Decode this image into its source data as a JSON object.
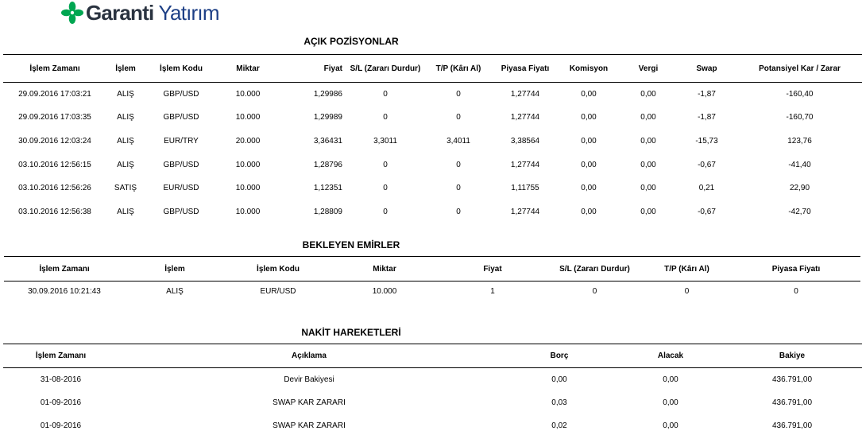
{
  "brand": {
    "name_part1": "Garanti",
    "name_part2": "Yatırım",
    "color_primary": "#2a3340",
    "color_secondary": "#1d3f86",
    "icon_color": "#00a651"
  },
  "open_positions": {
    "title": "AÇIK POZİSYONLAR",
    "columns": [
      "İşlem Zamanı",
      "İşlem",
      "İşlem Kodu",
      "Miktar",
      "Fiyat",
      "S/L (Zararı Durdur)",
      "T/P (Kârı Al)",
      "Piyasa Fiyatı",
      "Komisyon",
      "Vergi",
      "Swap",
      "Potansiyel Kar / Zarar"
    ],
    "rows": [
      [
        "29.09.2016 17:03:21",
        "ALIŞ",
        "GBP/USD",
        "10.000",
        "1,29986",
        "0",
        "0",
        "1,27744",
        "0,00",
        "0,00",
        "-1,87",
        "-160,40"
      ],
      [
        "29.09.2016 17:03:35",
        "ALIŞ",
        "GBP/USD",
        "10.000",
        "1,29989",
        "0",
        "0",
        "1,27744",
        "0,00",
        "0,00",
        "-1,87",
        "-160,70"
      ],
      [
        "30.09.2016 12:03:24",
        "ALIŞ",
        "EUR/TRY",
        "20.000",
        "3,36431",
        "3,3011",
        "3,4011",
        "3,38564",
        "0,00",
        "0,00",
        "-15,73",
        "123,76"
      ],
      [
        "03.10.2016 12:56:15",
        "ALIŞ",
        "GBP/USD",
        "10.000",
        "1,28796",
        "0",
        "0",
        "1,27744",
        "0,00",
        "0,00",
        "-0,67",
        "-41,40"
      ],
      [
        "03.10.2016 12:56:26",
        "SATIŞ",
        "EUR/USD",
        "10.000",
        "1,12351",
        "0",
        "0",
        "1,11755",
        "0,00",
        "0,00",
        "0,21",
        "22,90"
      ],
      [
        "03.10.2016 12:56:38",
        "ALIŞ",
        "GBP/USD",
        "10.000",
        "1,28809",
        "0",
        "0",
        "1,27744",
        "0,00",
        "0,00",
        "-0,67",
        "-42,70"
      ]
    ]
  },
  "pending_orders": {
    "title": "BEKLEYEN EMİRLER",
    "columns": [
      "İşlem Zamanı",
      "İşlem",
      "İşlem Kodu",
      "Miktar",
      "Fiyat",
      "S/L (Zararı Durdur)",
      "T/P (Kârı Al)",
      "Piyasa Fiyatı"
    ],
    "rows": [
      [
        "30.09.2016 10:21:43",
        "ALIŞ",
        "EUR/USD",
        "10.000",
        "1",
        "0",
        "0",
        "0"
      ]
    ]
  },
  "cash_movements": {
    "title": "NAKİT HAREKETLERİ",
    "columns": [
      "İşlem Zamanı",
      "Açıklama",
      "Borç",
      "Alacak",
      "Bakiye"
    ],
    "rows": [
      [
        "31-08-2016",
        "Devir Bakiyesi",
        "0,00",
        "0,00",
        "436.791,00"
      ],
      [
        "01-09-2016",
        "SWAP KAR ZARARI",
        "0,03",
        "0,00",
        "436.791,00"
      ],
      [
        "01-09-2016",
        "SWAP KAR ZARARI",
        "0,02",
        "0,00",
        "436.791,00"
      ]
    ]
  }
}
